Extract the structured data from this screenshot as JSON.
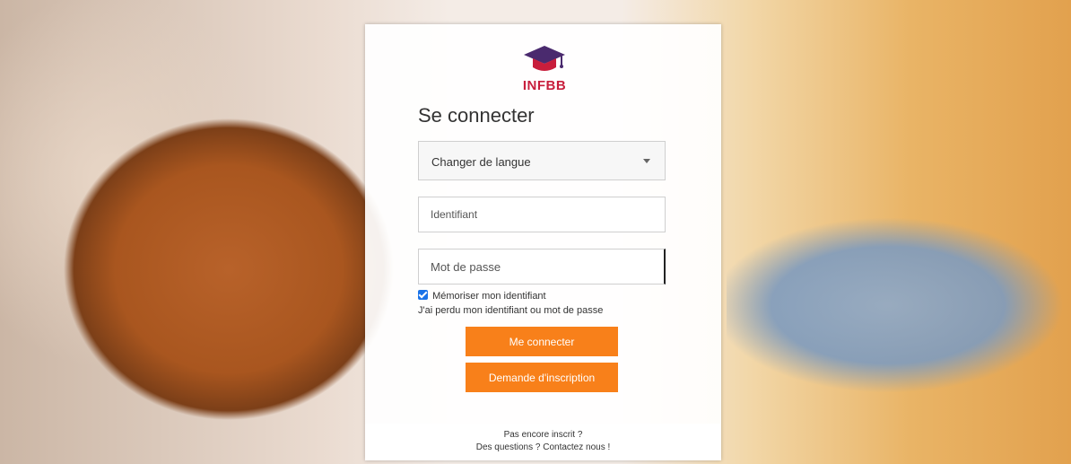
{
  "login": {
    "brand": "INFBB",
    "title": "Se connecter",
    "language_select": "Changer de langue",
    "username_placeholder": "Identifiant",
    "password_placeholder": "Mot de passe",
    "remember_label": "Mémoriser mon identifiant",
    "remember_checked": true,
    "lost_credentials_link": "J'ai perdu mon identifiant ou mot de passe",
    "login_button": "Me connecter",
    "register_button": "Demande d'inscription",
    "footer_line1": "Pas encore inscrit ?",
    "footer_line2": "Des questions ? Contactez nous !"
  },
  "colors": {
    "accent": "#f8801a",
    "brand_red": "#c81e3c",
    "brand_purple": "#4a2a6e"
  },
  "icons": [
    "graduation-cap-logo-icon",
    "chevron-down-icon",
    "checkbox-checked-icon"
  ]
}
